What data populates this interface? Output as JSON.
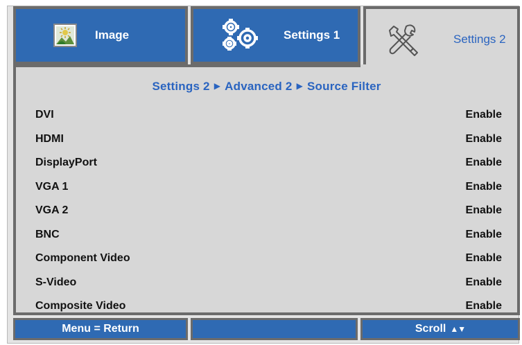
{
  "tabs": [
    {
      "label": "Image",
      "icon": "image-icon"
    },
    {
      "label": "Settings 1",
      "icon": "gears-icon"
    },
    {
      "label": "Settings 2",
      "icon": "tools-icon"
    }
  ],
  "breadcrumb": {
    "part1": "Settings 2",
    "part2": "Advanced 2",
    "part3": "Source Filter",
    "separator": "▶"
  },
  "rows": [
    {
      "label": "DVI",
      "value": "Enable"
    },
    {
      "label": "HDMI",
      "value": "Enable"
    },
    {
      "label": "DisplayPort",
      "value": "Enable"
    },
    {
      "label": "VGA 1",
      "value": "Enable"
    },
    {
      "label": "VGA 2",
      "value": "Enable"
    },
    {
      "label": "BNC",
      "value": "Enable"
    },
    {
      "label": "Component Video",
      "value": "Enable"
    },
    {
      "label": "S-Video",
      "value": "Enable"
    },
    {
      "label": "Composite Video",
      "value": "Enable"
    }
  ],
  "footer": {
    "menu_label": "Menu = Return",
    "middle_label": "",
    "scroll_label": "Scroll",
    "scroll_arrows": "▲▼"
  },
  "colors": {
    "tab_blue": "#2f6ab3",
    "accent_text": "#2a64c0",
    "panel_gray": "#d7d7d7",
    "border_gray": "#6b6b6b"
  }
}
